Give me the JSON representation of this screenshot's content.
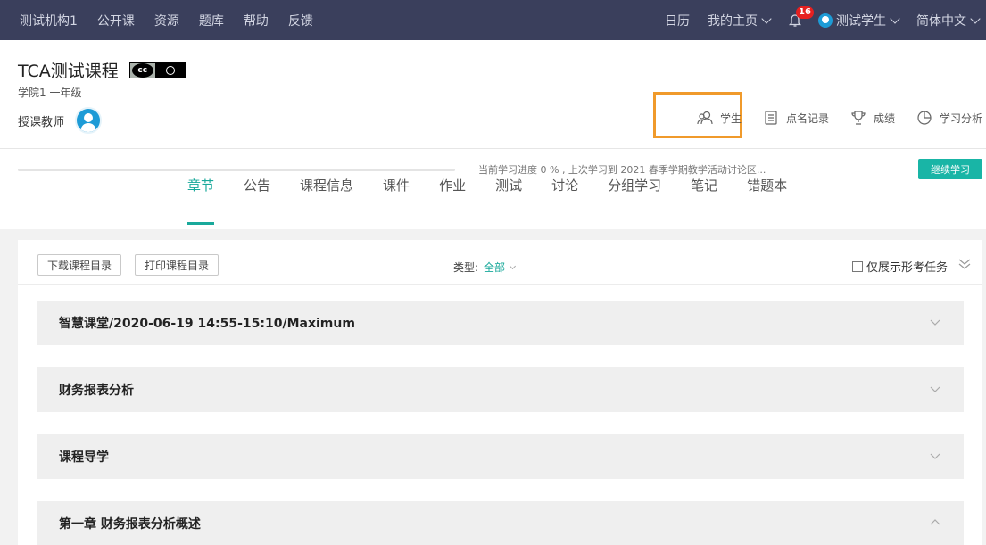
{
  "nav": {
    "left_links": [
      "测试机构1",
      "公开课",
      "资源",
      "题库",
      "帮助",
      "反馈"
    ],
    "calendar": "日历",
    "my_home": "我的主页",
    "notification_count": "16",
    "user_name": "测试学生",
    "language": "简体中文"
  },
  "course": {
    "title": "TCA测试课程",
    "sub": "学院1 一年级",
    "teacher_label": "授课教师"
  },
  "tools": {
    "students": "学生",
    "attendance": "点名记录",
    "grades": "成绩",
    "analysis": "学习分析"
  },
  "progress": {
    "percent": 0,
    "text": "当前学习进度 0 % , 上次学习到 2021 春季学期教学活动讨论区...",
    "continue_label": "继续学习"
  },
  "tabs": [
    "章节",
    "公告",
    "课程信息",
    "课件",
    "作业",
    "测试",
    "讨论",
    "分组学习",
    "笔记",
    "错题本"
  ],
  "active_tab": "章节",
  "toolbar": {
    "download_label": "下载课程目录",
    "print_label": "打印课程目录",
    "type_label": "类型:",
    "type_value": "全部",
    "only_form_label": "仅展示形考任务"
  },
  "chapters": [
    {
      "title": "智慧课堂/2020-06-19 14:55-15:10/Maximum",
      "expanded": false
    },
    {
      "title": "财务报表分析",
      "expanded": false
    },
    {
      "title": "课程导学",
      "expanded": false
    },
    {
      "title": "第一章 财务报表分析概述",
      "expanded": true
    }
  ],
  "colors": {
    "nav_bg": "#3a3f5c",
    "accent": "#19a99b",
    "highlight": "#f09a2b",
    "badge": "#e62020"
  }
}
